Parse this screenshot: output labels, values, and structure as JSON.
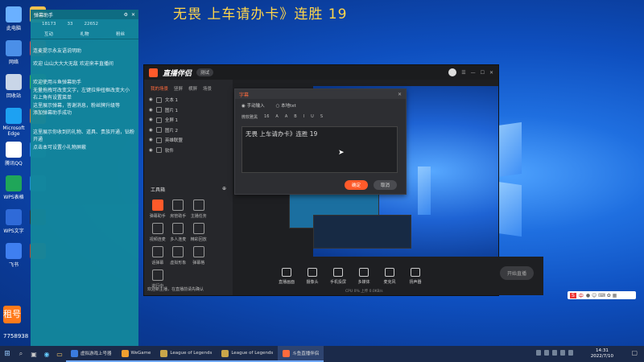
{
  "overlay_title": "无畏 上车请办卡》连胜 19",
  "desktop_icons": [
    {
      "label": "此电脑",
      "icon": "computer-icon",
      "color": "#6ab0ff"
    },
    {
      "label": "网络",
      "icon": "network-icon",
      "color": "#4b8fe8"
    },
    {
      "label": "回收站",
      "icon": "recycle-bin-icon",
      "color": "#c9d6e8"
    },
    {
      "label": "Microsoft Edge",
      "icon": "edge-icon",
      "color": "#1da1f2"
    },
    {
      "label": "腾讯QQ",
      "icon": "qq-icon",
      "color": "#ffffff"
    },
    {
      "label": "WPS表格",
      "icon": "wps-sheet-icon",
      "color": "#1fa659"
    },
    {
      "label": "WPS文字",
      "icon": "wps-writer-icon",
      "color": "#2f6ad8"
    },
    {
      "label": "飞书",
      "icon": "feishu-icon",
      "color": "#3f7ff0"
    }
  ],
  "desktop_icons_col2": [
    {
      "label": "",
      "icon": "folder-icon",
      "color": "#f2c14e"
    },
    {
      "label": "",
      "icon": "app-icon",
      "color": "#e24c4c"
    },
    {
      "label": "",
      "icon": "wechat-icon",
      "color": "#3bb54a"
    },
    {
      "label": "",
      "icon": "game-icon",
      "color": "#d47b2a"
    },
    {
      "label": "",
      "icon": "browser-icon",
      "color": "#2c8be8"
    },
    {
      "label": "",
      "icon": "edge-icon",
      "color": "#1e90d8"
    },
    {
      "label": "",
      "icon": "game-icon",
      "color": "#333333"
    },
    {
      "label": "",
      "icon": "game-icon",
      "color": "#b8462d"
    }
  ],
  "avatar": {
    "badge_text": "租号",
    "id_text": "7758938"
  },
  "chat": {
    "title": "弹幕助手",
    "stats": [
      "18173",
      "33",
      "22652"
    ],
    "tabs": [
      "互动",
      "礼物",
      "粉丝"
    ],
    "messages": [
      "连麦提示永友语说明助",
      "欢迎 山山大大大无敌 欢迎来丰直播间",
      "欢迎使用斗鱼弹幕助手",
      "无量拖拽可改变文字，左键拉伸扭框改变大小",
      "右上角有设置菜单",
      "这里展示弹幕，答谢消息，粉丝牌升级等",
      "添加弹幕助手成功",
      "这里展示你收到的礼物、道具、贵族开通，钻粉开通",
      "点击本可设置小礼物屏蔽"
    ]
  },
  "app": {
    "logo": "直播伴侣",
    "version": "测试",
    "left_tabs": [
      "我的场景",
      "竖屏",
      "横屏",
      "场景"
    ],
    "scenes": [
      "文本 1",
      "图片 1",
      "全屏 1",
      "图片 2",
      "英雄联盟",
      "软件"
    ],
    "tools_title": "工具箱",
    "tools": [
      "弹幕助手",
      "房管助手",
      "主播任务",
      "",
      "视频连麦",
      "多人连麦",
      "精彩回放",
      "",
      "话弹幕",
      "虚拟形象",
      "弹幕格",
      "",
      "进行中",
      "",
      "",
      ""
    ],
    "notice": "欢迎新主播，在直播前请先确认",
    "controls": [
      "直播画面",
      "摄像头",
      "手机投屏",
      "多媒体",
      "麦克风",
      "扬声器"
    ],
    "start_live": "开始直播",
    "speed_text": "CPU 0%  上传 0.0KB/s"
  },
  "dialog": {
    "title": "字幕",
    "options": [
      "手动输入",
      "本地txt"
    ],
    "toolbar": [
      "微软雅黑",
      "16",
      "A",
      "A",
      "B",
      "I",
      "U",
      "S"
    ],
    "text": "无畏 上车请办卡》连胜 19",
    "ok": "确定",
    "cancel": "取消"
  },
  "taskbar": {
    "items": [
      {
        "label": "虚拟游戏上号器",
        "color": "#3a7be0"
      },
      {
        "label": "WeGame",
        "color": "#f0a030"
      },
      {
        "label": "League of Legends",
        "color": "#c9a64a"
      },
      {
        "label": "League of Legends",
        "color": "#c9a64a"
      },
      {
        "label": "斗鱼直播伴侣",
        "color": "#ff6b3d"
      }
    ],
    "time": "14:31",
    "date": "2022/7/10"
  },
  "ime_text": "中"
}
